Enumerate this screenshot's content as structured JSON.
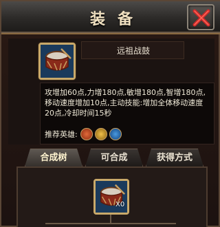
{
  "window": {
    "title": "装备",
    "close_label": "X",
    "accent_color": "#c9a96a",
    "close_color": "#d02a2a"
  },
  "item": {
    "name": "远祖战鼓",
    "icon": "war-drum-icon",
    "description": "攻增加60点,力增180点,敏增180点,智增180点,移动速度增加10点,主动技能:增加全体移动速度20点,冷却时间15秒",
    "recommend_label": "推荐英雄:",
    "recommended_heroes": [
      {
        "icon": "hero-icon-strength",
        "color": "#b8431c"
      },
      {
        "icon": "hero-icon-agility",
        "color": "#c49a2a"
      },
      {
        "icon": "hero-icon-intelligence",
        "color": "#2a6ab0"
      }
    ]
  },
  "tabs": [
    {
      "label": "合成树",
      "active": true
    },
    {
      "label": "可合成",
      "active": false
    },
    {
      "label": "获得方式",
      "active": false
    }
  ],
  "tree": {
    "root_icon": "war-drum-icon",
    "root_count": "X0"
  }
}
